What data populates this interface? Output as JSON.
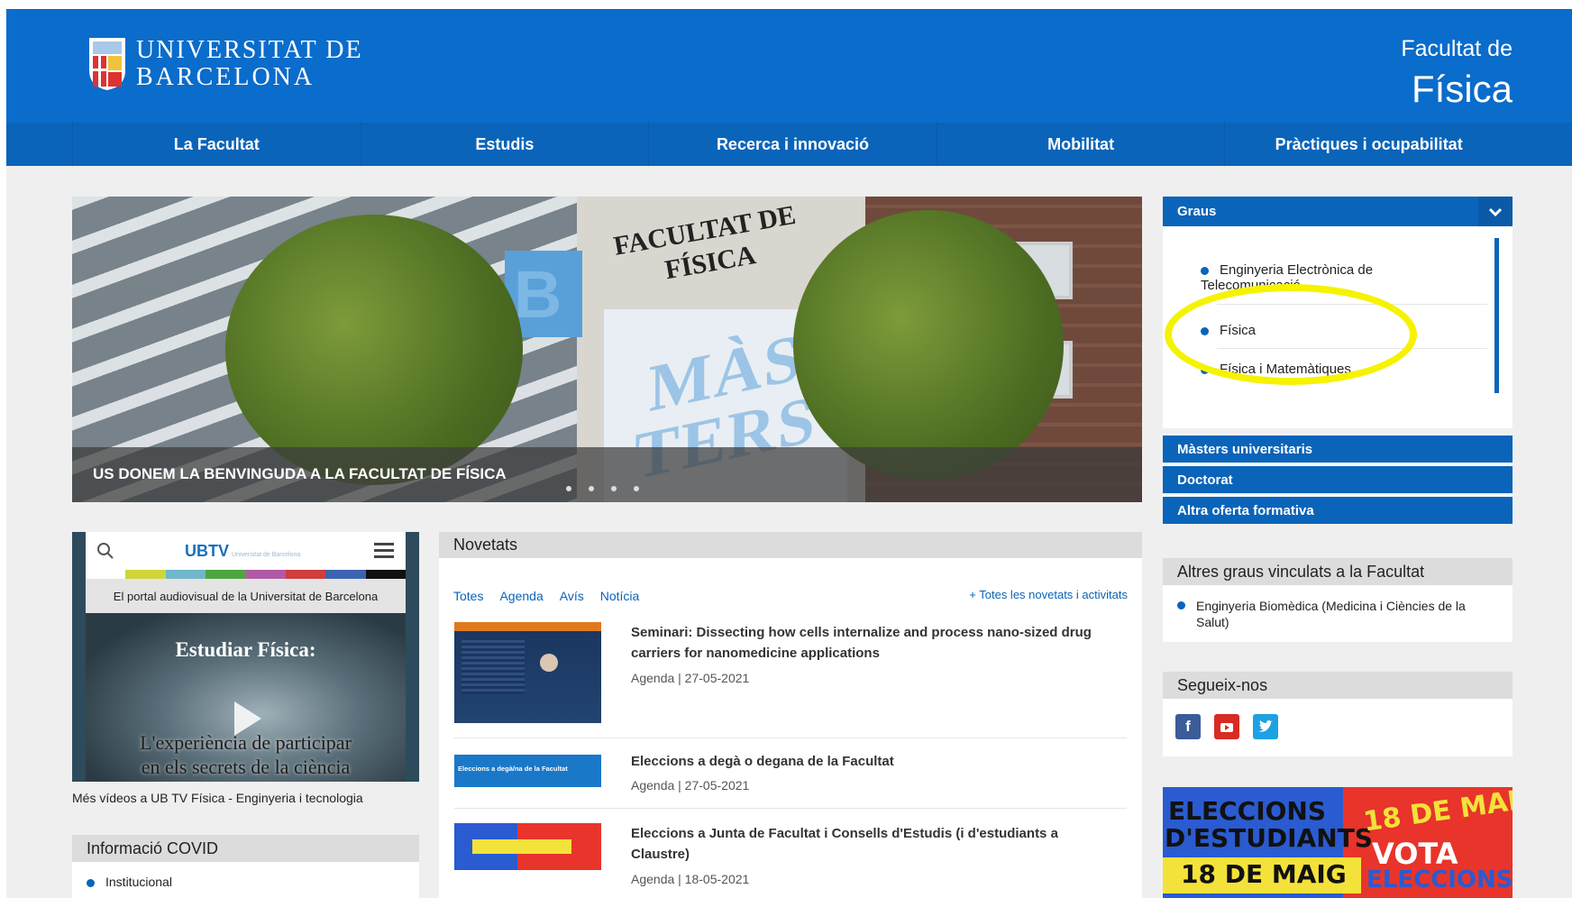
{
  "header": {
    "logo_line1": "UNIVERSITAT DE",
    "logo_line2": "BARCELONA",
    "faculty_line1": "Facultat de",
    "faculty_line2": "Física",
    "brand_color": "#0a6ccb"
  },
  "nav": {
    "items": [
      "La Facultat",
      "Estudis",
      "Recerca i innovació",
      "Mobilitat",
      "Pràctiques i ocupabilitat"
    ]
  },
  "hero": {
    "caption": "US DONEM LA BENVINGUDA A LA FACULTAT DE FÍSICA",
    "sign_text": "FACULTAT DE FÍSICA",
    "banner_text": "MÀS TERS",
    "slides": 4
  },
  "ubtv": {
    "logo": "UBTV",
    "logo_small": "Universitat de Barcelona",
    "tagline": "El portal audiovisual de la Universitat de Barcelona",
    "video_title": "Estudiar Física:",
    "video_subtitle_1": "L'experiència de participar",
    "video_subtitle_2": "en els secrets de la ciència",
    "more_link": "Més vídeos a UB TV Física - Enginyeria i tecnologia"
  },
  "covid": {
    "title": "Informació COVID",
    "items": [
      "Institucional"
    ]
  },
  "novetats": {
    "title": "Novetats",
    "filters": [
      "Totes",
      "Agenda",
      "Avís",
      "Notícia"
    ],
    "all_link": "+ Totes les novetats i activitats",
    "items": [
      {
        "title": "Seminari: Dissecting how cells internalize and process nano-sized drug carriers for nanomedicine applications",
        "meta": "Agenda | 27-05-2021"
      },
      {
        "title": "Eleccions a degà o degana de la Facultat",
        "meta": "Agenda | 27-05-2021",
        "thumb_text": "Eleccions a degà/na de la Facultat"
      },
      {
        "title": "Eleccions a Junta de Facultat i Consells d'Estudis (i d'estudiants a Claustre)",
        "meta": "Agenda | 18-05-2021"
      }
    ]
  },
  "graus": {
    "title": "Graus",
    "items": [
      "Enginyeria Electrònica de Telecomunicació",
      "Física",
      "Física i Matemàtiques"
    ],
    "links": [
      "Màsters universitaris",
      "Doctorat",
      "Altra oferta formativa"
    ]
  },
  "altres": {
    "title": "Altres graus vinculats a la Facultat",
    "items": [
      "Enginyeria Biomèdica (Medicina i Ciències de la Salut)"
    ]
  },
  "segueix": {
    "title": "Segueix-nos",
    "icons": [
      "facebook-icon",
      "youtube-icon",
      "twitter-icon"
    ],
    "colors": {
      "facebook": "#3b5b99",
      "youtube": "#d82b24",
      "twitter": "#1da1e2"
    }
  },
  "banner": {
    "line1": "ELECCIONS",
    "line2": "D'ESTUDIANTS",
    "line3": "18 DE MAIG",
    "vote": "VOTA"
  },
  "annotation": {
    "color": "#f5f300"
  }
}
